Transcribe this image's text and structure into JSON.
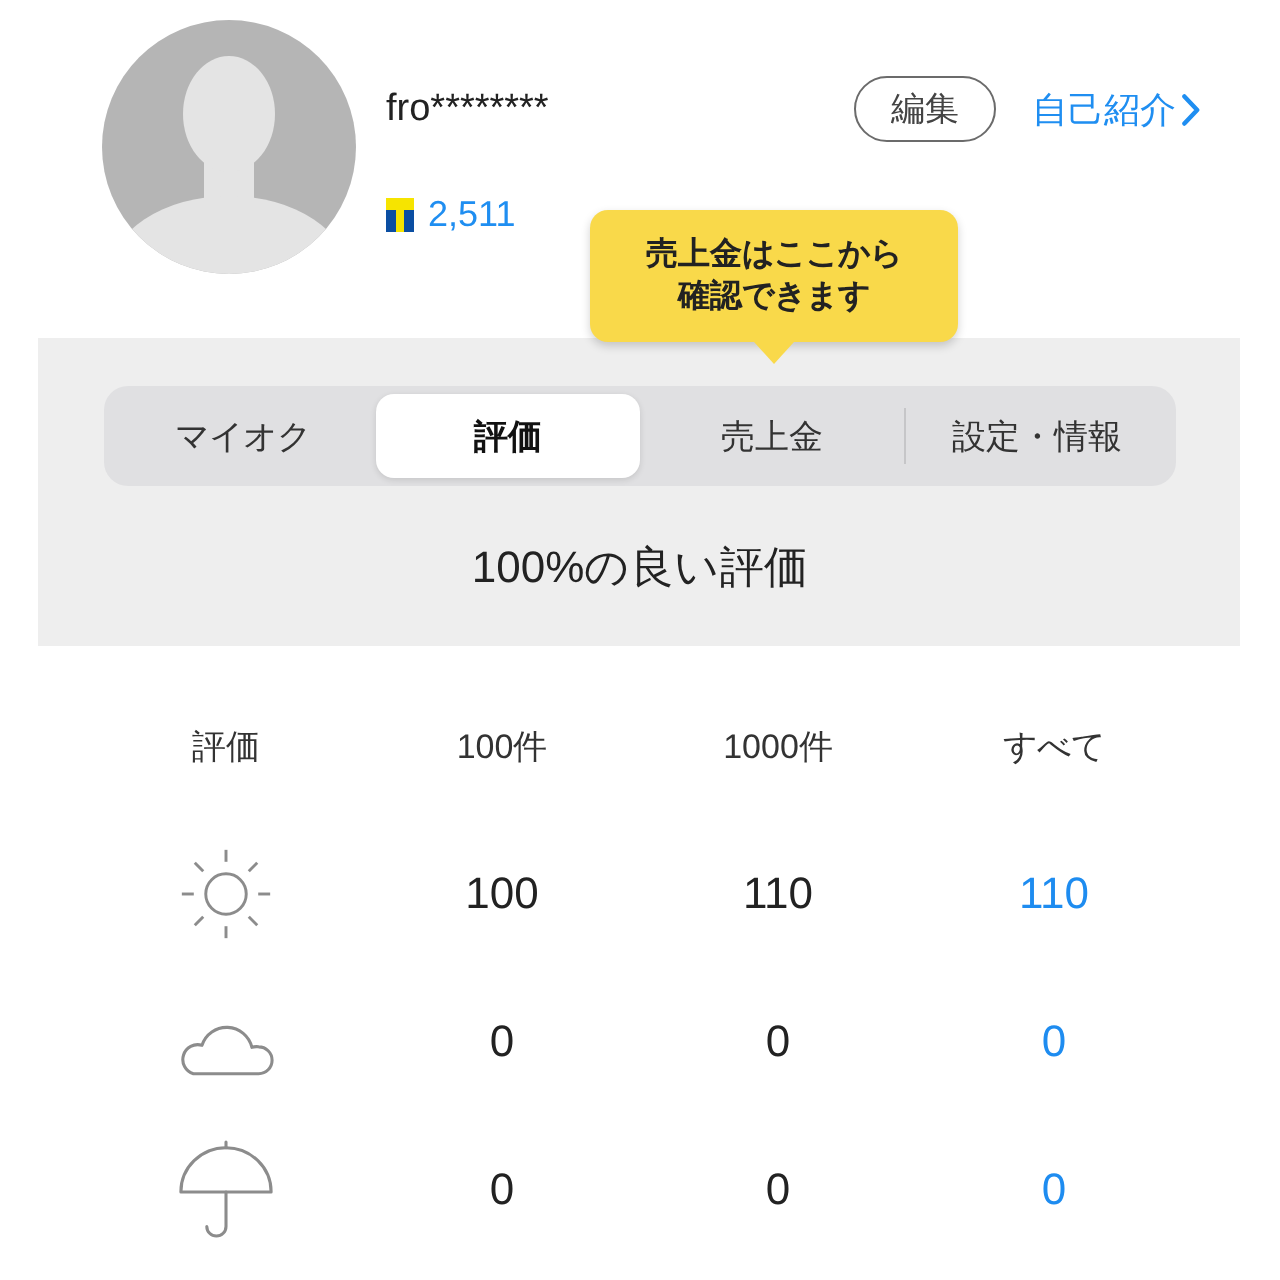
{
  "profile": {
    "username": "fro********",
    "edit_button": "編集",
    "intro_link": "自己紹介",
    "points": "2,511"
  },
  "tooltip": {
    "text": "売上金はここから確認できます"
  },
  "tabs": [
    {
      "label": "マイオク",
      "selected": false
    },
    {
      "label": "評価",
      "selected": true
    },
    {
      "label": "売上金",
      "selected": false
    },
    {
      "label": "設定・情報",
      "selected": false
    }
  ],
  "summary": "100%の良い評価",
  "ratings": {
    "columns": [
      "評価",
      "100件",
      "1000件",
      "すべて"
    ],
    "rows": [
      {
        "kind": "good",
        "values": [
          "100",
          "110",
          "110"
        ]
      },
      {
        "kind": "normal",
        "values": [
          "0",
          "0",
          "0"
        ]
      },
      {
        "kind": "bad",
        "values": [
          "0",
          "0",
          "0"
        ]
      }
    ]
  }
}
